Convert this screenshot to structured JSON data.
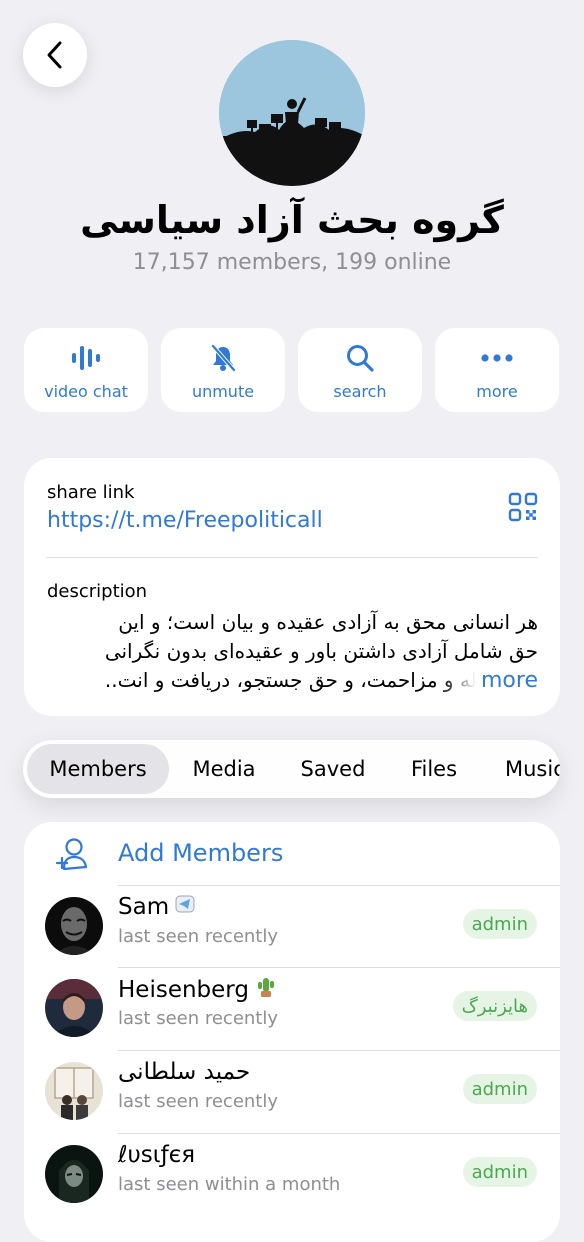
{
  "header": {
    "title": "گروه بحث آزاد سیاسی",
    "subtitle": "17,157 members, 199 online"
  },
  "actions": [
    {
      "label": "video chat",
      "icon": "video-chat-icon"
    },
    {
      "label": "unmute",
      "icon": "bell-slash-icon"
    },
    {
      "label": "search",
      "icon": "search-icon"
    },
    {
      "label": "more",
      "icon": "more-dots-icon"
    }
  ],
  "info": {
    "share_label": "share link",
    "share_url": "https://t.me/Freepoliticall",
    "description_label": "description",
    "description_lines": [
      "هر انسانی محق به آزادی عقیده و بیان است؛ و این",
      "حق شامل آزادی داشتن باور و عقیده‌ای بدون نگرانی",
      "از مداخله و مزاحمت، و حق جستجو، دریافت و انت.."
    ],
    "more_label": "more"
  },
  "tabs": [
    "Members",
    "Media",
    "Saved",
    "Files",
    "Music"
  ],
  "members": {
    "add_label": "Add Members",
    "list": [
      {
        "name": "Sam",
        "status": "last seen recently",
        "badge": "admin",
        "emoji": "telegram-icon"
      },
      {
        "name": "Heisenberg",
        "status": "last seen recently",
        "badge": "هایزنبرگ",
        "emoji": "cactus-icon"
      },
      {
        "name": "حمید سلطانی",
        "status": "last seen recently",
        "badge": "admin",
        "emoji": ""
      },
      {
        "name": "ℓυsιƒєя",
        "status": "last seen within a month",
        "badge": "admin",
        "emoji": ""
      }
    ]
  },
  "colors": {
    "accent": "#2f7ad6",
    "background": "#efeff4",
    "badge_bg": "#e6f4e6",
    "badge_text": "#4aa84f"
  }
}
